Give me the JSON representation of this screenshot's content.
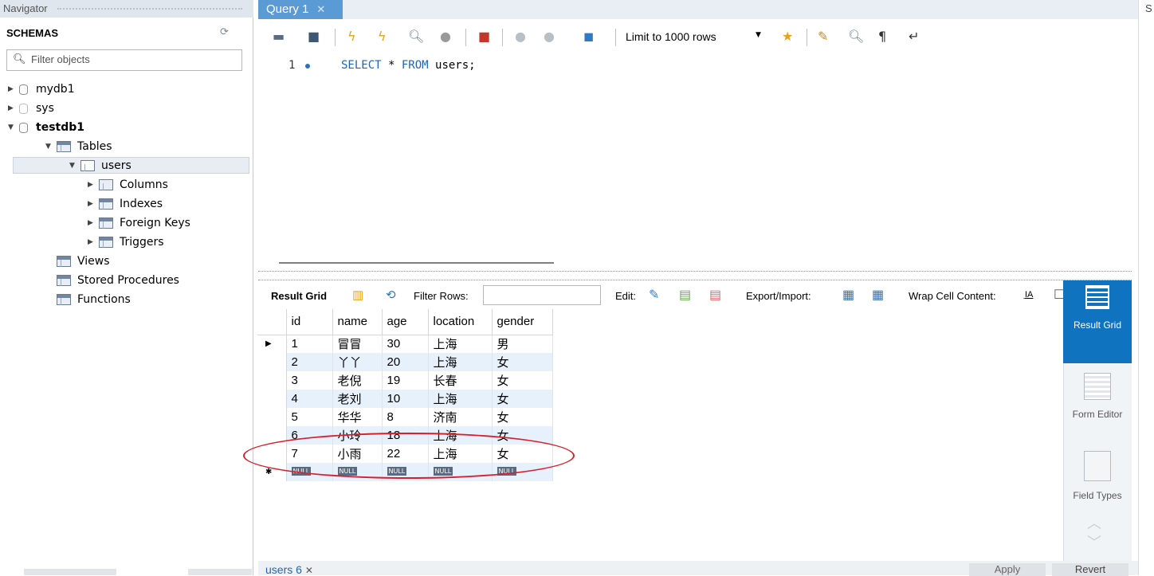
{
  "navigator": {
    "header": "Navigator",
    "schemas_label": "SCHEMAS",
    "filter_placeholder": "Filter objects",
    "tree": {
      "db1": "mydb1",
      "db2": "sys",
      "db3": "testdb1",
      "tables": "Tables",
      "users": "users",
      "columns": "Columns",
      "indexes": "Indexes",
      "foreign_keys": "Foreign Keys",
      "triggers": "Triggers",
      "views": "Views",
      "stored_procedures": "Stored Procedures",
      "functions": "Functions"
    }
  },
  "editor": {
    "tab_label": "Query 1",
    "limit_label": "Limit to 1000 rows",
    "line_number": "1",
    "sql": {
      "kw1": "SELECT",
      "rest1": " * ",
      "kw2": "FROM",
      "rest2": " users;"
    }
  },
  "result": {
    "result_grid_label": "Result Grid",
    "filter_rows_label": "Filter Rows:",
    "edit_label": "Edit:",
    "export_label": "Export/Import:",
    "wrap_label": "Wrap Cell Content:",
    "columns": [
      "id",
      "name",
      "age",
      "location",
      "gender"
    ],
    "rows": [
      [
        "1",
        "冒冒",
        "30",
        "上海",
        "男"
      ],
      [
        "2",
        "丫丫",
        "20",
        "上海",
        "女"
      ],
      [
        "3",
        "老倪",
        "19",
        "长春",
        "女"
      ],
      [
        "4",
        "老刘",
        "10",
        "上海",
        "女"
      ],
      [
        "5",
        "华华",
        "8",
        "济南",
        "女"
      ],
      [
        "6",
        "小玲",
        "18",
        "上海",
        "女"
      ],
      [
        "7",
        "小雨",
        "22",
        "上海",
        "女"
      ]
    ],
    "null_label": "NULL"
  },
  "side_panel": {
    "result_grid": "Result Grid",
    "form_editor": "Form Editor",
    "field_types": "Field Types"
  },
  "bottom": {
    "tab_label": "users 6",
    "apply": "Apply",
    "revert": "Revert"
  },
  "right_panel_letter": "S",
  "accent_color": "#0f73c0",
  "highlight_color": "#d7202d"
}
